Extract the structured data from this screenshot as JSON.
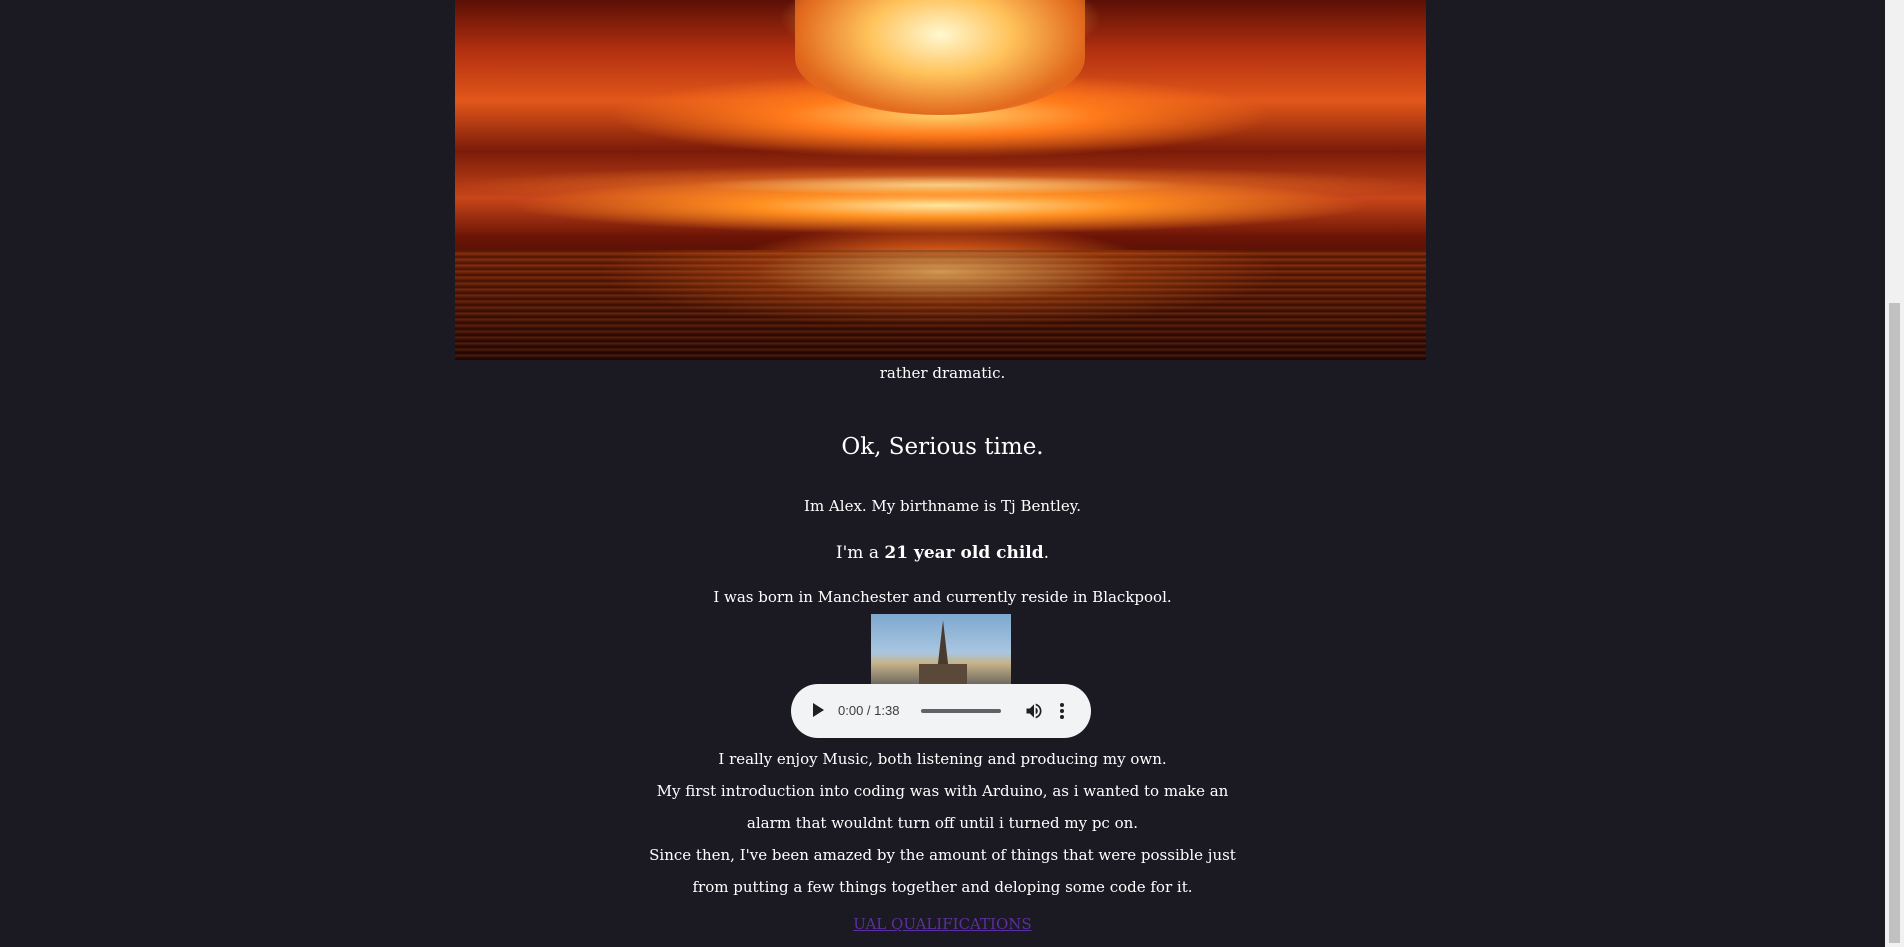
{
  "hero": {
    "image_name": "nuclear-explosion-image",
    "caption": "rather dramatic."
  },
  "about": {
    "heading": "Ok, Serious time.",
    "intro": "Im Alex. My birthname is Tj Bentley.",
    "age_prefix": "I'm a ",
    "age_bold": "21 year old child",
    "age_suffix": ".",
    "born": "I was born in Manchester and currently reside in Blackpool.",
    "tower_image_name": "blackpool-tower-image"
  },
  "audio": {
    "time": "0:00 / 1:38",
    "progress": 0,
    "icons": [
      "play-icon",
      "volume-icon",
      "more-options-icon"
    ]
  },
  "story": {
    "lines": [
      "I really enjoy Music, both listening and producing my own.",
      "My first introduction into coding was with Arduino, as i wanted to make an",
      "alarm that wouldnt turn off until i turned my pc on.",
      "Since then, I've been amazed by the amount of things that were possible just",
      "from putting a few things together and deloping some code for it."
    ]
  },
  "links": {
    "qualifications": "UAL QUALIFICATIONS"
  },
  "colors": {
    "background": "#1b1a22",
    "text": "#ffffff",
    "link": "#5a2fa0"
  }
}
